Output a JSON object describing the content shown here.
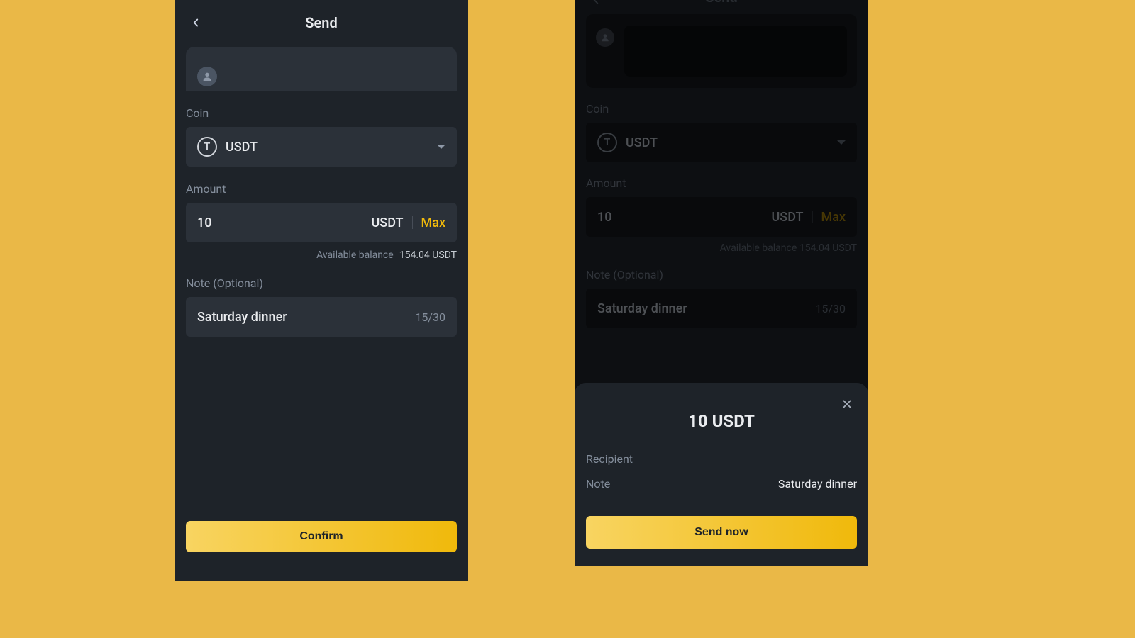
{
  "left": {
    "header_title": "Send",
    "coin_label": "Coin",
    "coin_name": "USDT",
    "coin_glyph": "T",
    "amount_label": "Amount",
    "amount_value": "10",
    "amount_unit": "USDT",
    "max_label": "Max",
    "balance_label": "Available balance",
    "balance_value": "154.04 USDT",
    "note_label": "Note (Optional)",
    "note_value": "Saturday dinner",
    "note_count": "15/30",
    "confirm_label": "Confirm"
  },
  "right": {
    "header_title": "Send",
    "coin_label": "Coin",
    "coin_name": "USDT",
    "coin_glyph": "T",
    "amount_label": "Amount",
    "amount_value": "10",
    "amount_unit": "USDT",
    "max_label": "Max",
    "balance_line": "Available balance  154.04 USDT",
    "note_label": "Note (Optional)",
    "note_value": "Saturday dinner",
    "note_count": "15/30",
    "sheet": {
      "amount": "10 USDT",
      "recipient_label": "Recipient",
      "note_label": "Note",
      "note_value": "Saturday dinner",
      "send_label": "Send now"
    }
  }
}
